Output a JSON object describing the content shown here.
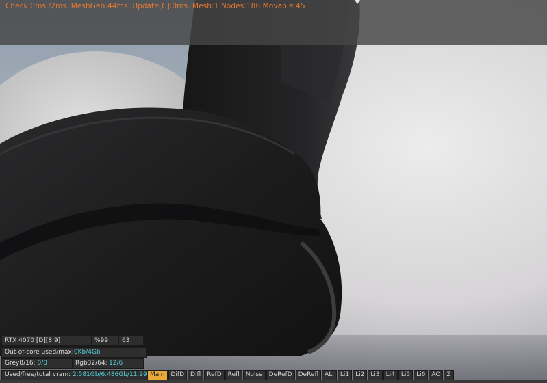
{
  "stats": {
    "line": "Check:0ms./2ms. MeshGen:44ms. Update[C]:0ms. Mesh:1 Nodes:186 Movable:45"
  },
  "device": {
    "name": "RTX 4070 [D][8.9]",
    "usage": "%99",
    "temp": "63"
  },
  "out_of_core": {
    "label": "Out-of-core used/max:",
    "value": "0Kb/4Gb"
  },
  "grey": {
    "label": "Grey8/16:",
    "value": "0/0",
    "rgb_label": "Rgb32/64:",
    "rgb_value": "12/6"
  },
  "vram": {
    "label": "Used/free/total vram:",
    "value": "2.581Gb/6.486Gb/11.99"
  },
  "passes": [
    "Main",
    "DifD",
    "Difl",
    "RefD",
    "Refl",
    "Noise",
    "DeRefD",
    "DeRefl",
    "ALi",
    "Li1",
    "Li2",
    "Li3",
    "Li4",
    "Li5",
    "Li6",
    "AO",
    "Z"
  ],
  "active_pass": "Main",
  "colors": {
    "accent": "#54d1d8",
    "active_tab": "#e8a93a",
    "stats_text": "#e07a33"
  }
}
